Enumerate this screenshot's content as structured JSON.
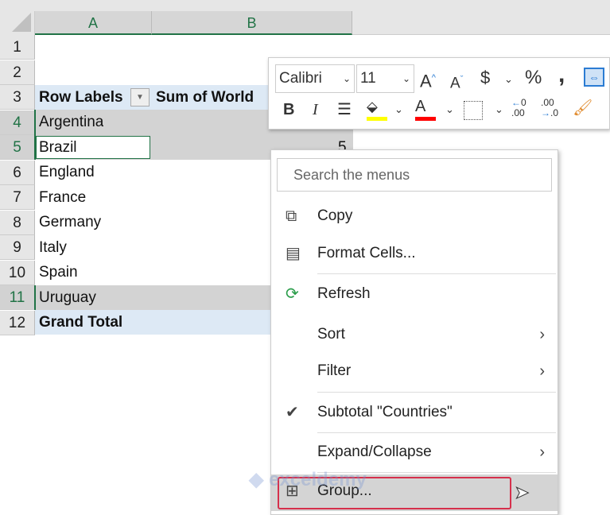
{
  "columns": [
    "A",
    "B"
  ],
  "rows": [
    "1",
    "2",
    "3",
    "4",
    "5",
    "6",
    "7",
    "8",
    "9",
    "10",
    "11",
    "12"
  ],
  "pivot": {
    "row_labels_header": "Row Labels",
    "value_header": "Sum of World",
    "items": [
      "Argentina",
      "Brazil",
      "England",
      "France",
      "Germany",
      "Italy",
      "Spain",
      "Uruguay"
    ],
    "grand_total": "Grand Total",
    "brazil_value": "5"
  },
  "toolbar": {
    "font": "Calibri",
    "size": "11",
    "fill_color": "#ffff00",
    "font_color": "#ff0000"
  },
  "menu": {
    "search_placeholder": "Search the menus",
    "items": [
      {
        "label": "Copy"
      },
      {
        "label": "Format Cells..."
      },
      {
        "label": "Refresh"
      },
      {
        "label": "Sort"
      },
      {
        "label": "Filter"
      },
      {
        "label": "Subtotal \"Countries\""
      },
      {
        "label": "Expand/Collapse"
      },
      {
        "label": "Group..."
      }
    ]
  },
  "watermark": "exceldemy"
}
